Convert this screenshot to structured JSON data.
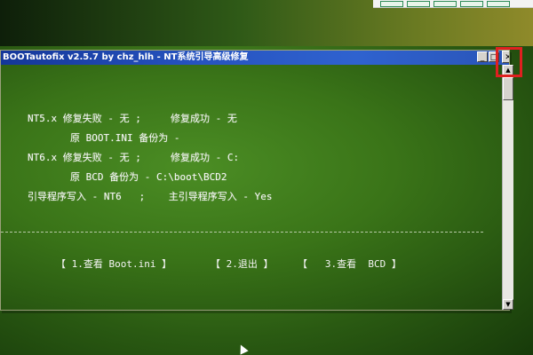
{
  "window": {
    "title": "BOOTautofix v2.5.7 by chz_hlh - NT系统引导高级修复",
    "min_glyph": "_",
    "max_glyph": "□",
    "close_glyph": "✕"
  },
  "status": {
    "nt5": "NT5.x 修复失败 - 无 ;     修复成功 - 无",
    "nt5_backup": "原 BOOT.INI 备份为 -",
    "nt6": "NT6.x 修复失败 - 无 ;     修复成功 - C:",
    "nt6_backup": "原 BCD 备份为 - C:\\boot\\BCD2",
    "boot_write": "引导程序写入 - NT6   ;    主引导程序写入 - Yes"
  },
  "menu": {
    "view_boot_ini": "【 1.查看 Boot.ini 】",
    "exit": "【 2.退出 】",
    "view_bcd": "【   3.查看  BCD 】"
  },
  "colors": {
    "titlebar": "#2754c0",
    "window_bg": "#3a7418",
    "text": "#f5f5f5",
    "highlight": "#e02020"
  },
  "icons": {
    "scroll_up": "up-arrow-icon",
    "scroll_down": "down-arrow-icon",
    "mouse_pointer": "mouse-pointer-icon"
  }
}
